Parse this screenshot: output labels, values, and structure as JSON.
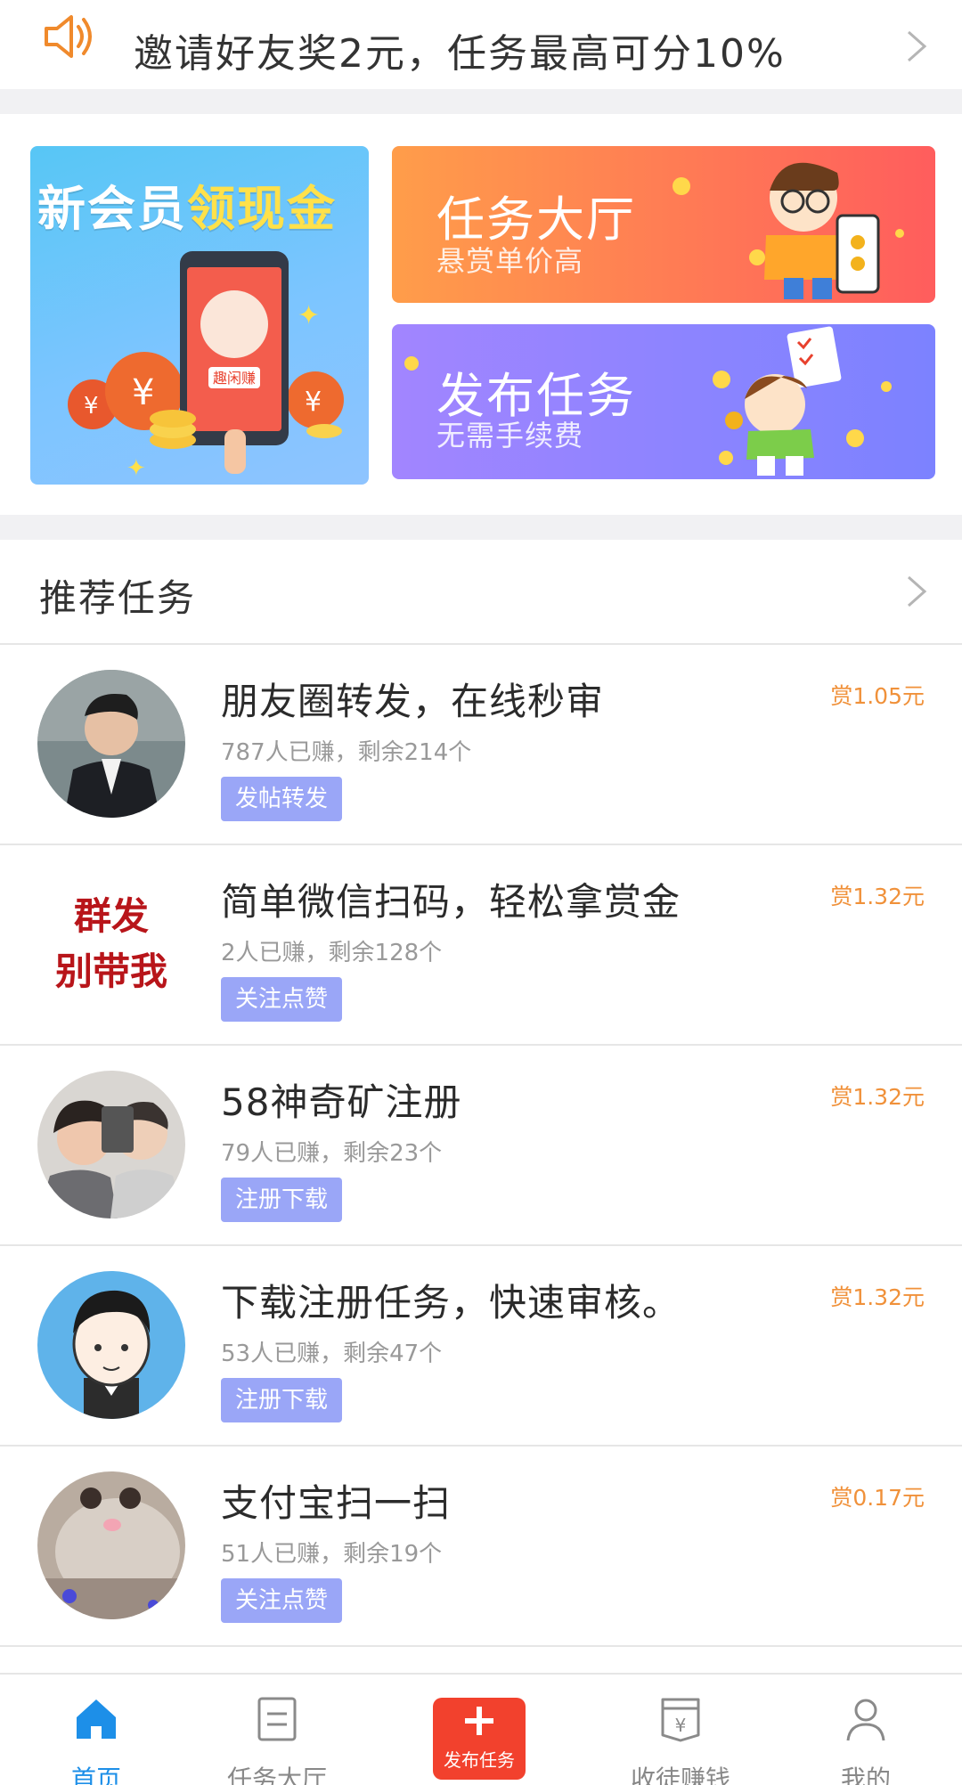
{
  "notice": {
    "icon": "speaker-icon",
    "text": "邀请好友奖2元，任务最高可分10%"
  },
  "banners": {
    "promo": {
      "title_plain": "新会员",
      "title_highlight": "领现金",
      "phone_label": "趣闲赚"
    },
    "hall": {
      "title": "任务大厅",
      "subtitle": "悬赏单价高"
    },
    "publish": {
      "title": "发布任务",
      "subtitle": "无需手续费"
    }
  },
  "section": {
    "title": "推荐任务"
  },
  "tasks": [
    {
      "title": "朋友圈转发，在线秒审",
      "meta": "787人已赚，剩余214个",
      "tag": "发帖转发",
      "reward": "赏1.05元"
    },
    {
      "title": "简单微信扫码，轻松拿赏金",
      "meta": "2人已赚，剩余128个",
      "tag": "关注点赞",
      "reward": "赏1.32元",
      "avatar_lines": [
        "群发",
        "别带我"
      ]
    },
    {
      "title": "58神奇矿注册",
      "meta": "79人已赚，剩余23个",
      "tag": "注册下载",
      "reward": "赏1.32元"
    },
    {
      "title": "下载注册任务，快速审核。",
      "meta": "53人已赚，剩余47个",
      "tag": "注册下载",
      "reward": "赏1.32元"
    },
    {
      "title": "支付宝扫一扫",
      "meta": "51人已赚，剩余19个",
      "tag": "关注点赞",
      "reward": "赏0.17元"
    }
  ],
  "tabbar": {
    "home": "首页",
    "hall": "任务大厅",
    "publish": "发布任务",
    "recruit": "收徒赚钱",
    "mine": "我的"
  },
  "colors": {
    "accent_blue": "#1d8fe8",
    "reward_orange": "#f0913a",
    "tag_purple": "#9aa6f7",
    "publish_red": "#f2412d"
  }
}
